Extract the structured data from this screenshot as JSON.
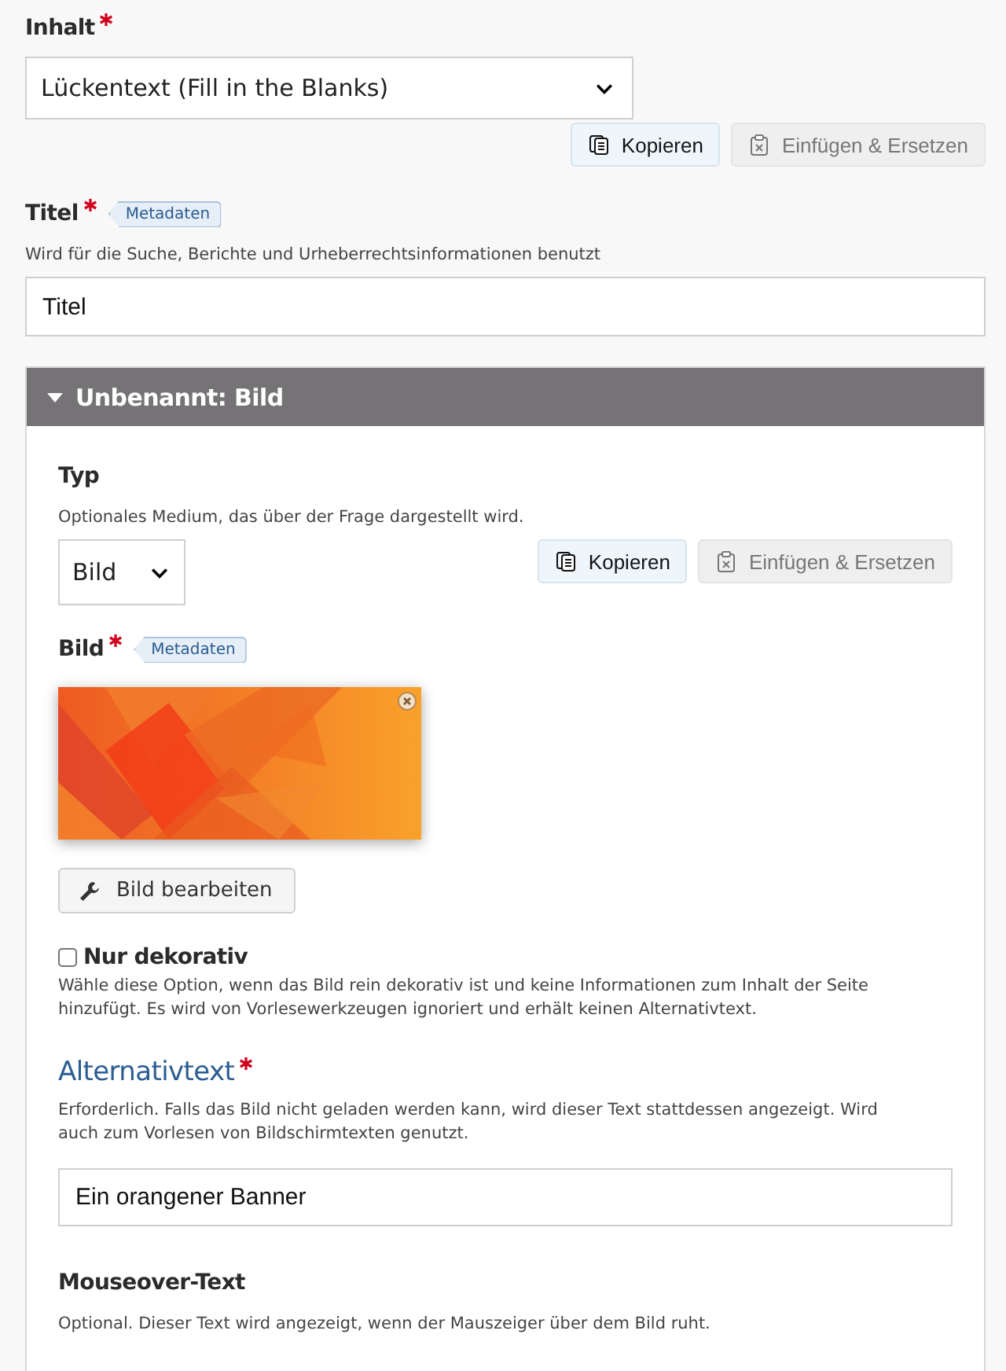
{
  "content_field": {
    "label": "Inhalt",
    "required": true,
    "value": "Lückentext (Fill in the Blanks)"
  },
  "content_actions": [
    {
      "kind": "copy",
      "label": "Kopieren",
      "disabled": false
    },
    {
      "kind": "paste",
      "label": "Einfügen & Ersetzen",
      "disabled": true
    }
  ],
  "title_field": {
    "label": "Titel",
    "required": true,
    "badge": "Metadaten",
    "description": "Wird für die Suche, Berichte und Urheberrechtsinformationen benutzt",
    "value": "Titel"
  },
  "group": {
    "title": "Unbenannt: Bild",
    "expanded": true,
    "type_field": {
      "label": "Typ",
      "description": "Optionales Medium, das über der Frage dargestellt wird.",
      "value": "Bild"
    },
    "type_actions": [
      {
        "kind": "copy",
        "label": "Kopieren",
        "disabled": false
      },
      {
        "kind": "paste",
        "label": "Einfügen & Ersetzen",
        "disabled": true
      }
    ],
    "image_field": {
      "label": "Bild",
      "required": true,
      "badge": "Metadaten",
      "edit_button": "Bild bearbeiten"
    },
    "decorative": {
      "label": "Nur dekorativ",
      "checked": false,
      "description": "Wähle diese Option, wenn das Bild rein dekorativ ist und keine Informationen zum Inhalt der Seite hinzufügt. Es wird von Vorlesewerkzeugen ignoriert und erhält keinen Alternativtext."
    },
    "alt_text": {
      "label": "Alternativtext",
      "required": true,
      "description": "Erforderlich. Falls das Bild nicht geladen werden kann, wird dieser Text stattdessen angezeigt. Wird auch zum Vorlesen von Bildschirmtexten genutzt.",
      "value": "Ein orangener Banner"
    },
    "hover_text": {
      "label": "Mouseover-Text",
      "description": "Optional. Dieser Text wird angezeigt, wenn der Mauszeiger über dem Bild ruht."
    }
  }
}
